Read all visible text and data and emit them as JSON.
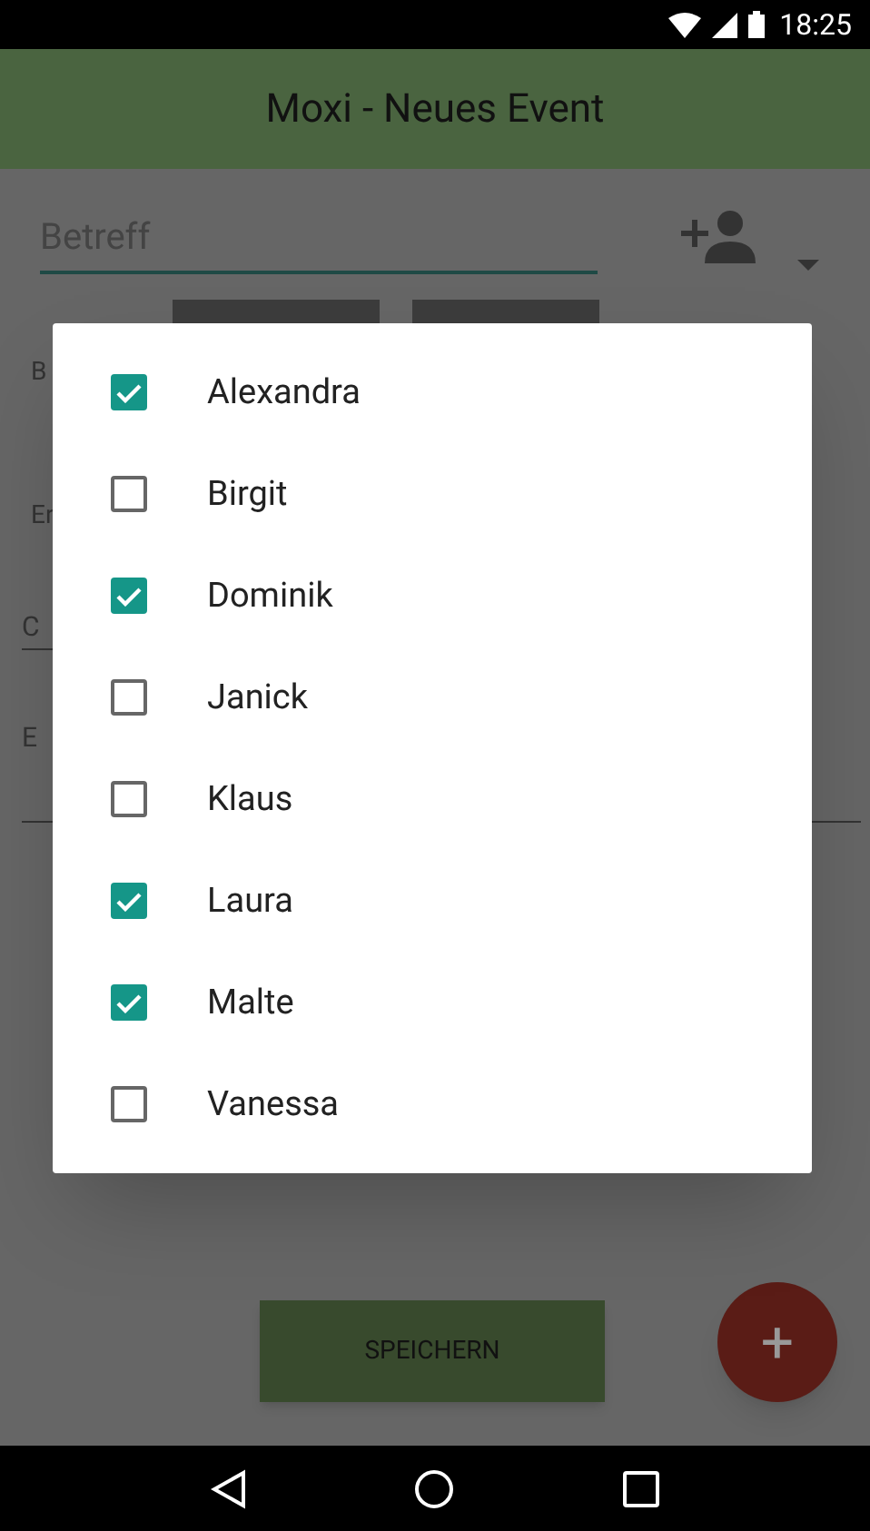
{
  "status_bar": {
    "time": "18:25"
  },
  "app_bar": {
    "title": "Moxi - Neues Event"
  },
  "form": {
    "subject_placeholder": "Betreff",
    "labels": [
      "B",
      "Er"
    ],
    "fields": [
      "C",
      "E"
    ],
    "save_button": "SPEICHERN",
    "fab": "+"
  },
  "dialog": {
    "items": [
      {
        "label": "Alexandra",
        "checked": true
      },
      {
        "label": "Birgit",
        "checked": false
      },
      {
        "label": "Dominik",
        "checked": true
      },
      {
        "label": "Janick",
        "checked": false
      },
      {
        "label": "Klaus",
        "checked": false
      },
      {
        "label": "Laura",
        "checked": true
      },
      {
        "label": "Malte",
        "checked": true
      },
      {
        "label": "Vanessa",
        "checked": false
      }
    ]
  }
}
